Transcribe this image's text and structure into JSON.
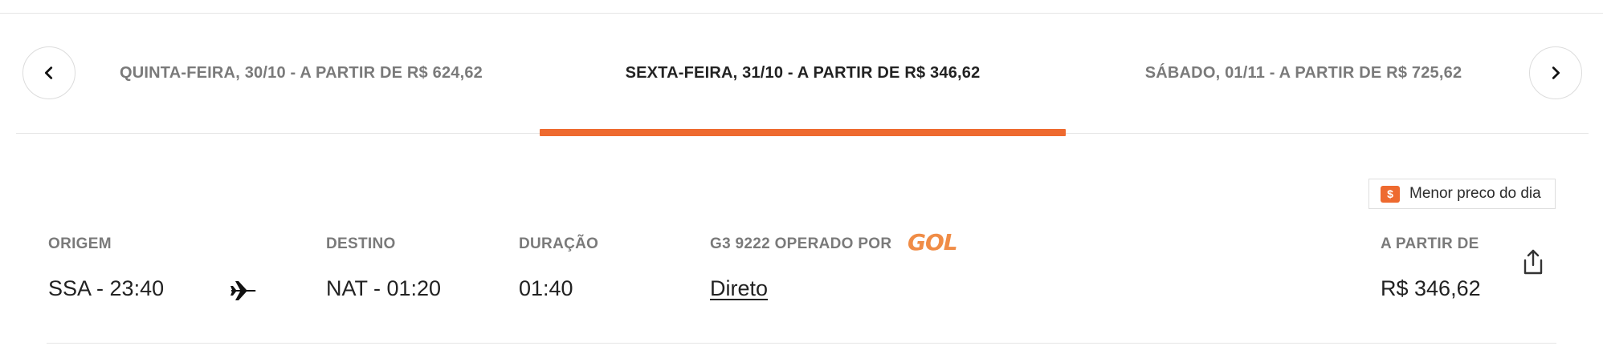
{
  "tabs": [
    {
      "label": "QUINTA-FEIRA, 30/10 - A PARTIR DE R$ 624,62",
      "active": false
    },
    {
      "label": "SEXTA-FEIRA, 31/10 - A PARTIR DE R$ 346,62",
      "active": true
    },
    {
      "label": "SÁBADO, 01/11 - A PARTIR DE R$ 725,62",
      "active": false
    }
  ],
  "icons": {
    "prev": "chevron-left-icon",
    "next": "chevron-right-icon",
    "plane": "plane-icon",
    "share": "share-icon",
    "badge": "dollar-icon"
  },
  "badge": {
    "symbol": "$",
    "label": "Menor preco do dia"
  },
  "flight": {
    "origin_label": "ORIGEM",
    "origin_value": "SSA - 23:40",
    "destination_label": "DESTINO",
    "destination_value": "NAT - 01:20",
    "duration_label": "DURAÇÃO",
    "duration_value": "01:40",
    "operated_label": "G3 9222 OPERADO POR",
    "airline_logo_text": "GOL",
    "stops_value": "Direto",
    "price_label": "A PARTIR DE",
    "price_value": "R$ 346,62"
  },
  "colors": {
    "accent": "#ee6a2f",
    "gol_brand": "#f08c46",
    "muted_text": "#7a7a7a",
    "text": "#222222"
  }
}
